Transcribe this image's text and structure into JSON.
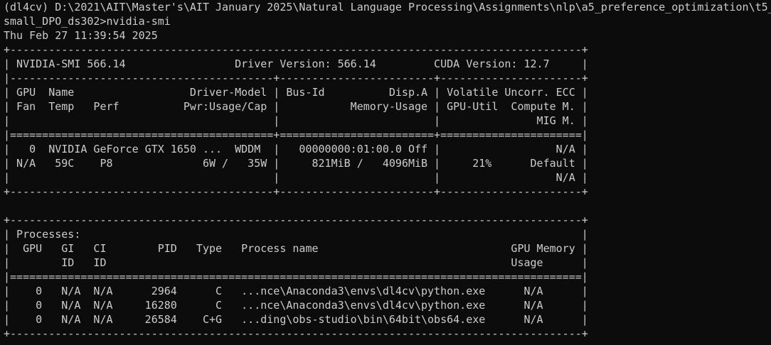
{
  "terminal": {
    "prompt_line_1": "(dl4cv) D:\\2021\\AIT\\Master's\\AIT January 2025\\Natural Language Processing\\Assignments\\nlp\\a5_preference_optimization\\t5_",
    "prompt_line_2": "small_DPO_ds302>nvidia-smi",
    "timestamp": "Thu Feb 27 11:39:54 2025",
    "output_lines": [
      "+-----------------------------------------------------------------------------------------+",
      "| NVIDIA-SMI 566.14                 Driver Version: 566.14         CUDA Version: 12.7     |",
      "|-----------------------------------------+------------------------+----------------------+",
      "| GPU  Name                  Driver-Model | Bus-Id          Disp.A | Volatile Uncorr. ECC |",
      "| Fan  Temp   Perf          Pwr:Usage/Cap |           Memory-Usage | GPU-Util  Compute M. |",
      "|                                         |                        |               MIG M. |",
      "|=========================================+========================+======================|",
      "|   0  NVIDIA GeForce GTX 1650 ...  WDDM  |   00000000:01:00.0 Off |                  N/A |",
      "| N/A   59C    P8              6W /   35W |     821MiB /   4096MiB |     21%      Default |",
      "|                                         |                        |                  N/A |",
      "+-----------------------------------------+------------------------+----------------------+",
      "",
      "+-----------------------------------------------------------------------------------------+",
      "| Processes:                                                                              |",
      "|  GPU   GI   CI        PID   Type   Process name                              GPU Memory |",
      "|        ID   ID                                                               Usage      |",
      "|=========================================================================================|",
      "|    0   N/A  N/A      2964      C   ...nce\\Anaconda3\\envs\\dl4cv\\python.exe      N/A      |",
      "|    0   N/A  N/A     16280      C   ...nce\\Anaconda3\\envs\\dl4cv\\python.exe      N/A      |",
      "|    0   N/A  N/A     26584    C+G   ...ding\\obs-studio\\bin\\64bit\\obs64.exe      N/A      |",
      "+-----------------------------------------------------------------------------------------+"
    ]
  },
  "colors": {
    "background": "#0c0c0c",
    "foreground": "#cccccc"
  }
}
